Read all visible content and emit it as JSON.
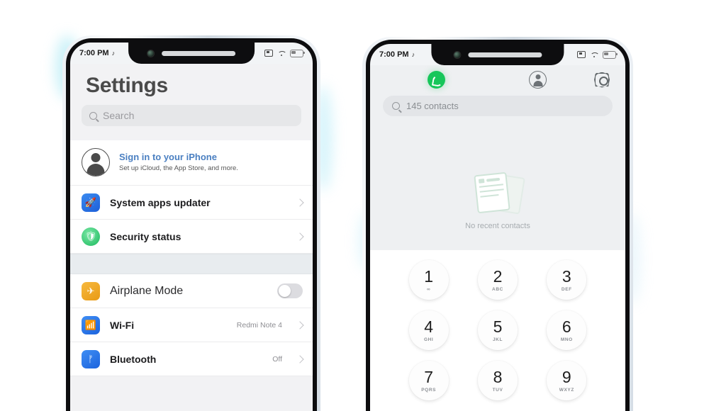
{
  "statusbar": {
    "time": "7:00 PM",
    "mute_icon": "mute-icon",
    "screenshot_icon": "screenshot-icon",
    "wifi_icon": "wifi-icon",
    "battery_icon": "battery-icon"
  },
  "settings_phone": {
    "title": "Settings",
    "search_placeholder": "Search",
    "account": {
      "title": "Sign in to your iPhone",
      "subtitle": "Set up iCloud, the App Store, and more.",
      "avatar_icon": "person-avatar-icon",
      "title_color": "#4a7fc1"
    },
    "group1": [
      {
        "label": "System apps updater",
        "icon": "rocket-icon",
        "icon_color": "#2a73e8",
        "value": "",
        "accessory": "chevron"
      },
      {
        "label": "Security status",
        "icon": "shield-icon",
        "icon_color": "#19b85c",
        "value": "",
        "accessory": "chevron"
      }
    ],
    "group2": [
      {
        "label": "Airplane Mode",
        "icon": "airplane-icon",
        "icon_color": "#f0a51f",
        "value": "",
        "accessory": "toggle",
        "toggle_on": false
      },
      {
        "label": "Wi-Fi",
        "icon": "wifi-icon",
        "icon_color": "#2a73e8",
        "value": "Redmi Note 4",
        "accessory": "chevron"
      },
      {
        "label": "Bluetooth",
        "icon": "bluetooth-icon",
        "icon_color": "#2a73e8",
        "value": "Off",
        "accessory": "chevron"
      }
    ]
  },
  "dialer_phone": {
    "tabs": [
      {
        "name": "keypad",
        "icon": "phone-icon",
        "active": true,
        "color": "#16c65a"
      },
      {
        "name": "contacts",
        "icon": "contacts-icon",
        "active": false
      },
      {
        "name": "settings",
        "icon": "gear-icon",
        "active": false
      }
    ],
    "search_placeholder": "145 contacts",
    "empty_state": {
      "text": "No recent contacts",
      "icon": "empty-contacts-cards-icon"
    },
    "keypad": [
      [
        {
          "digit": "1",
          "letters": "∞"
        },
        {
          "digit": "2",
          "letters": "ABC"
        },
        {
          "digit": "3",
          "letters": "DEF"
        }
      ],
      [
        {
          "digit": "4",
          "letters": "GHI"
        },
        {
          "digit": "5",
          "letters": "JKL"
        },
        {
          "digit": "6",
          "letters": "MNO"
        }
      ],
      [
        {
          "digit": "7",
          "letters": "PQRS"
        },
        {
          "digit": "8",
          "letters": "TUV"
        },
        {
          "digit": "9",
          "letters": "WXYZ"
        }
      ]
    ]
  }
}
